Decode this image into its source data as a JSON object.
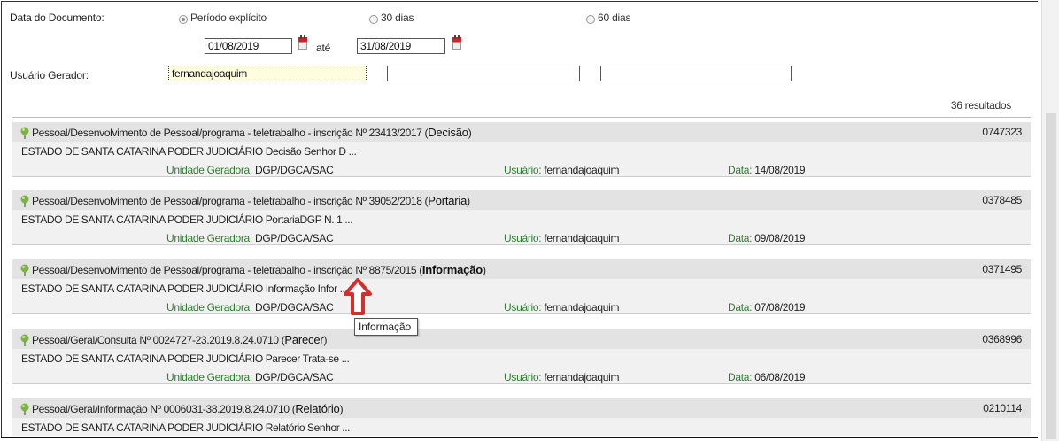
{
  "filters": {
    "date_label": "Data do Documento:",
    "radio_options": [
      {
        "label": "Período explícito",
        "checked": true
      },
      {
        "label": "30 dias",
        "checked": false
      },
      {
        "label": "60 dias",
        "checked": false
      }
    ],
    "date_from": "01/08/2019",
    "date_until_label": "até",
    "date_to": "31/08/2019",
    "user_label": "Usuário Gerador:",
    "user_values": [
      "fernandajoaquim",
      "",
      ""
    ]
  },
  "results_count": "36 resultados",
  "meta_labels": {
    "unit": "Unidade Geradora:",
    "user": "Usuário:",
    "date": "Data:"
  },
  "results": [
    {
      "title": "Pessoal/Desenvolvimento de Pessoal/programa - teletrabalho - inscrição Nº 23413/2017 (",
      "kind": "Decisão",
      "close": ")",
      "number": "0747323",
      "snippet": "ESTADO DE SANTA CATARINA PODER JUDICIÁRIO Decisão Senhor D ...",
      "unit": "DGP/DGCA/SAC",
      "user": "fernandajoaquim",
      "date": "14/08/2019"
    },
    {
      "title": "Pessoal/Desenvolvimento de Pessoal/programa - teletrabalho - inscrição Nº 39052/2018 (",
      "kind": "Portaria",
      "close": ")",
      "number": "0378485",
      "snippet": "ESTADO DE SANTA CATARINA PODER JUDICIÁRIO PortariaDGP N. 1 ...",
      "unit": "DGP/DGCA/SAC",
      "user": "fernandajoaquim",
      "date": "09/08/2019"
    },
    {
      "title": "Pessoal/Desenvolvimento de Pessoal/programa - teletrabalho - inscrição Nº 8875/2015 (",
      "kind": "Informação",
      "close": ")",
      "number": "0371495",
      "snippet": "ESTADO DE SANTA CATARINA PODER JUDICIÁRIO Informação Infor ...",
      "unit": "DGP/DGCA/SAC",
      "user": "fernandajoaquim",
      "date": "07/08/2019"
    },
    {
      "title": "Pessoal/Geral/Consulta Nº 0024727-23.2019.8.24.0710 (",
      "kind": "Parecer",
      "close": ")",
      "number": "0368996",
      "snippet": "ESTADO DE SANTA CATARINA PODER JUDICIÁRIO Parecer Trata-se ...",
      "unit": "DGP/DGCA/SAC",
      "user": "fernandajoaquim",
      "date": "06/08/2019"
    },
    {
      "title": "Pessoal/Geral/Informação Nº 0006031-38.2019.8.24.0710 (",
      "kind": "Relatório",
      "close": ")",
      "number": "0210114",
      "snippet": "ESTADO DE SANTA CATARINA PODER JUDICIÁRIO Relatório Senhor ...",
      "unit": "",
      "user": "",
      "date": ""
    }
  ],
  "tooltip": "Informação",
  "colors": {
    "meta_label": "#2e7d32",
    "row_header": "#e3e3e3",
    "row_body": "#f1f1f1",
    "arrow": "#d32f2f"
  }
}
